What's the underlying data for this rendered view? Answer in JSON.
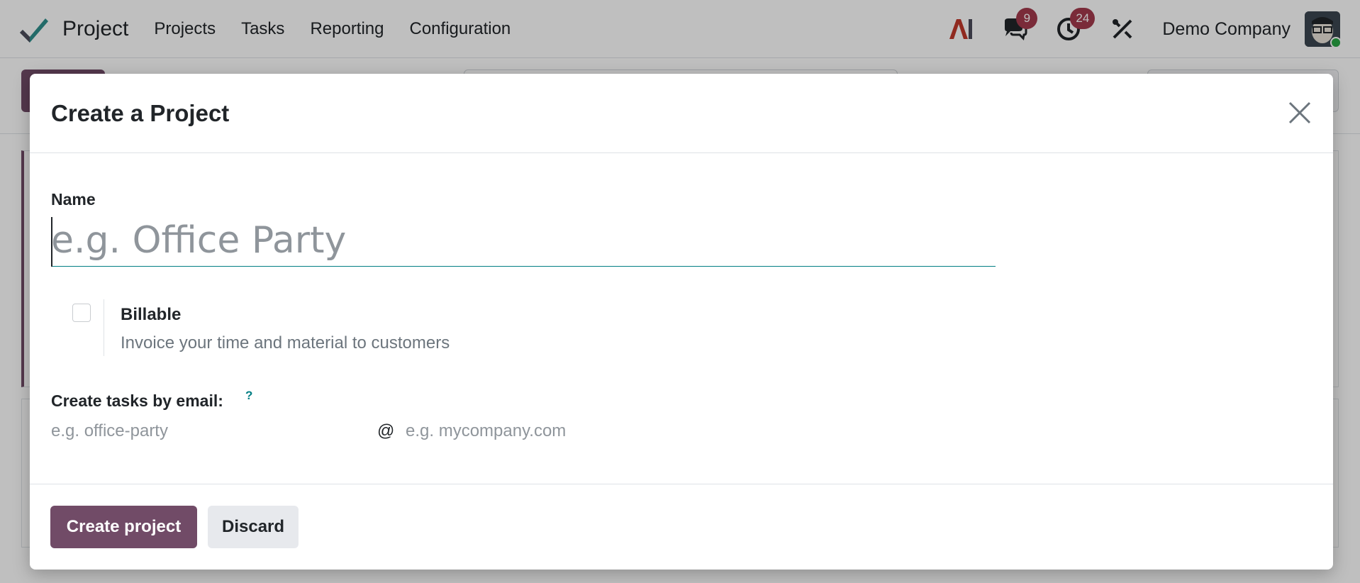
{
  "app": {
    "name": "Project",
    "menu": [
      "Projects",
      "Tasks",
      "Reporting",
      "Configuration"
    ]
  },
  "systray": {
    "ai_label": "AI",
    "messages_count": "9",
    "activities_count": "24",
    "company": "Demo Company"
  },
  "modal": {
    "title": "Create a Project",
    "name_label": "Name",
    "name_placeholder": "e.g. Office Party",
    "billable_label": "Billable",
    "billable_description": "Invoice your time and material to customers",
    "email_label": "Create tasks by email:",
    "help_mark": "?",
    "alias_placeholder": "e.g. office-party",
    "at_sign": "@",
    "domain_placeholder": "e.g. mycompany.com",
    "create_button": "Create project",
    "discard_button": "Discard"
  },
  "colors": {
    "brand": "#714b67",
    "accent": "#017e84",
    "badge": "#a33a4c"
  },
  "icons": [
    "project-logo-icon",
    "ai-icon",
    "chat-icon",
    "clock-icon",
    "tools-icon",
    "close-icon"
  ]
}
